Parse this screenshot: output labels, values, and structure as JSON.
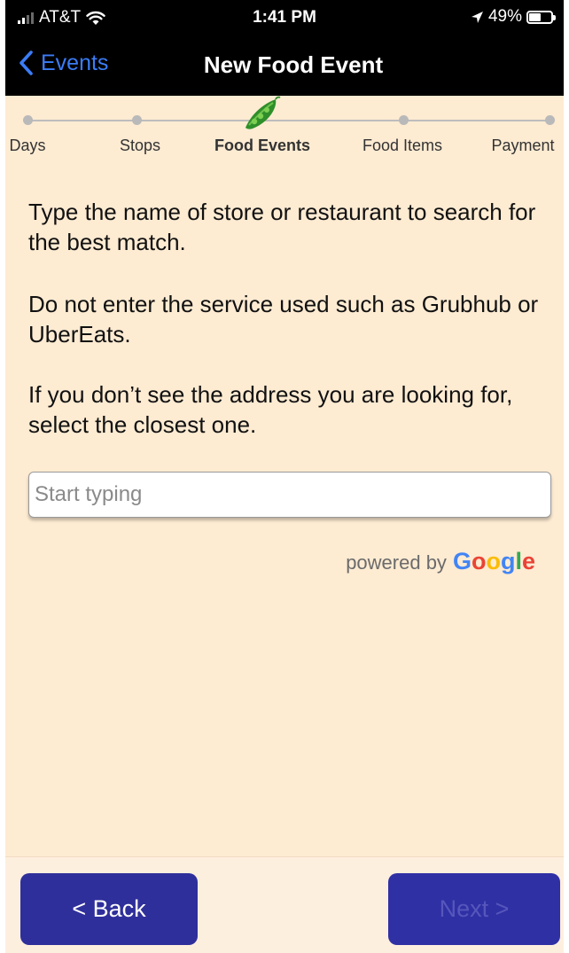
{
  "status_bar": {
    "carrier": "AT&T",
    "time": "1:41 PM",
    "battery_percent": "49%",
    "battery_level": 0.49,
    "icons": [
      "signal-icon",
      "wifi-icon",
      "location-arrow-icon",
      "battery-icon"
    ]
  },
  "nav": {
    "back_label": "Events",
    "title": "New Food Event"
  },
  "stepper": {
    "steps": [
      {
        "label": "Days",
        "state": "done"
      },
      {
        "label": "Stops",
        "state": "done"
      },
      {
        "label": "Food Events",
        "state": "current"
      },
      {
        "label": "Food Items",
        "state": "todo"
      },
      {
        "label": "Payment",
        "state": "todo"
      }
    ],
    "current_icon": "pea-pod-icon"
  },
  "instructions": {
    "p1": "Type the name of store or restaurant to search for the best match.",
    "p2": "Do not enter the service used such as Grubhub or UberEats.",
    "p3": "If you don’t see the address you are looking for, select the closest one."
  },
  "search": {
    "placeholder": "Start typing",
    "value": ""
  },
  "attribution": {
    "powered_by": "powered by",
    "brand": "Google",
    "brand_colors": [
      "#4285F4",
      "#EA4335",
      "#FBBC05",
      "#4285F4",
      "#34A853",
      "#EA4335"
    ]
  },
  "buttons": {
    "back": "< Back",
    "next": "Next >"
  },
  "colors": {
    "accent_blue": "#3b7cf6",
    "button_blue": "#2f2f9b",
    "background": "#fdebd2"
  }
}
